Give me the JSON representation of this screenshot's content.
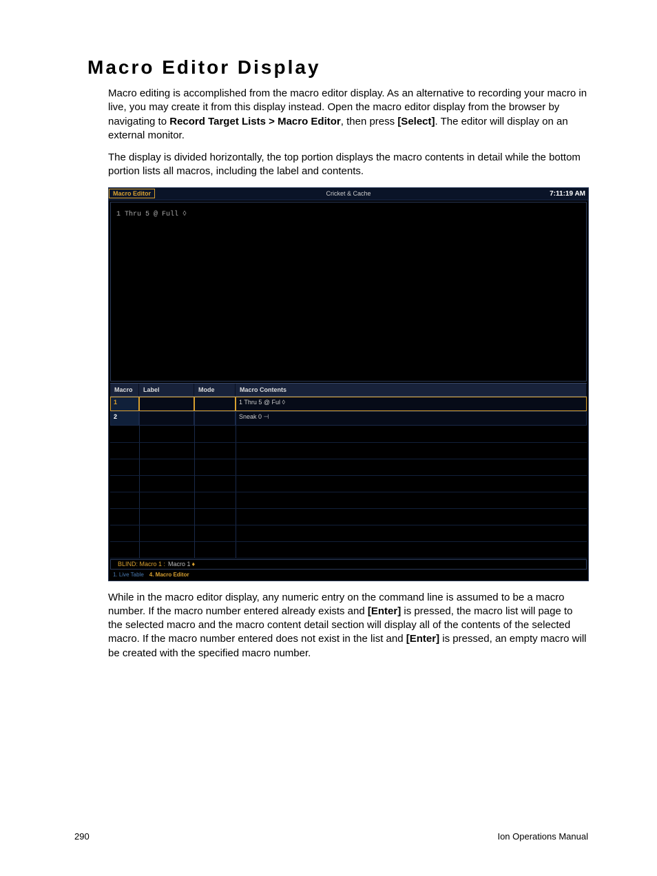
{
  "heading": "Macro Editor Display",
  "para1_a": "Macro editing is accomplished from the macro editor display. As an alternative to recording your macro in live, you may create it from this display instead. Open the macro editor display from the browser by navigating to ",
  "para1_b": "Record Target Lists > Macro Editor",
  "para1_c": ", then press ",
  "para1_d": "[Select]",
  "para1_e": ". The editor will display on an external monitor.",
  "para2": "The display is divided horizontally, the top portion displays the macro contents in detail while the bottom portion lists all macros, including the label and contents.",
  "para3_a": "While in the macro editor display, any numeric entry on the command line is assumed to be a macro number. If the macro number entered already exists and ",
  "para3_b": "[Enter]",
  "para3_c": " is pressed, the macro list will page to the selected macro and the macro content detail section will display all of the contents of the selected macro. If the macro number entered does not exist in the list and ",
  "para3_d": "[Enter]",
  "para3_e": " is pressed, an empty macro will be created with the specified macro number.",
  "screenshot": {
    "top_tab": "Macro Editor",
    "show_name": "Cricket & Cache",
    "clock": "7:11:19 AM",
    "detail_line": "1 Thru 5 @ Full ◊",
    "columns": {
      "macro": "Macro",
      "label": "Label",
      "mode": "Mode",
      "contents": "Macro Contents"
    },
    "rows": [
      {
        "macro": "1",
        "label": "",
        "mode": "",
        "contents": "1 Thru 5 @ Ful ◊",
        "selected": true
      },
      {
        "macro": "2",
        "label": "",
        "mode": "",
        "contents": "Sneak 0 ⊣",
        "selected": false
      }
    ],
    "cmd_prefix": "BLIND: Macro  1 :",
    "cmd_text": "Macro 1",
    "cmd_arrow": "♦",
    "bottom_tabs": {
      "t1": "1. Live Table",
      "t2": "4. Macro Editor"
    }
  },
  "footer": {
    "page": "290",
    "manual": "Ion Operations Manual"
  }
}
